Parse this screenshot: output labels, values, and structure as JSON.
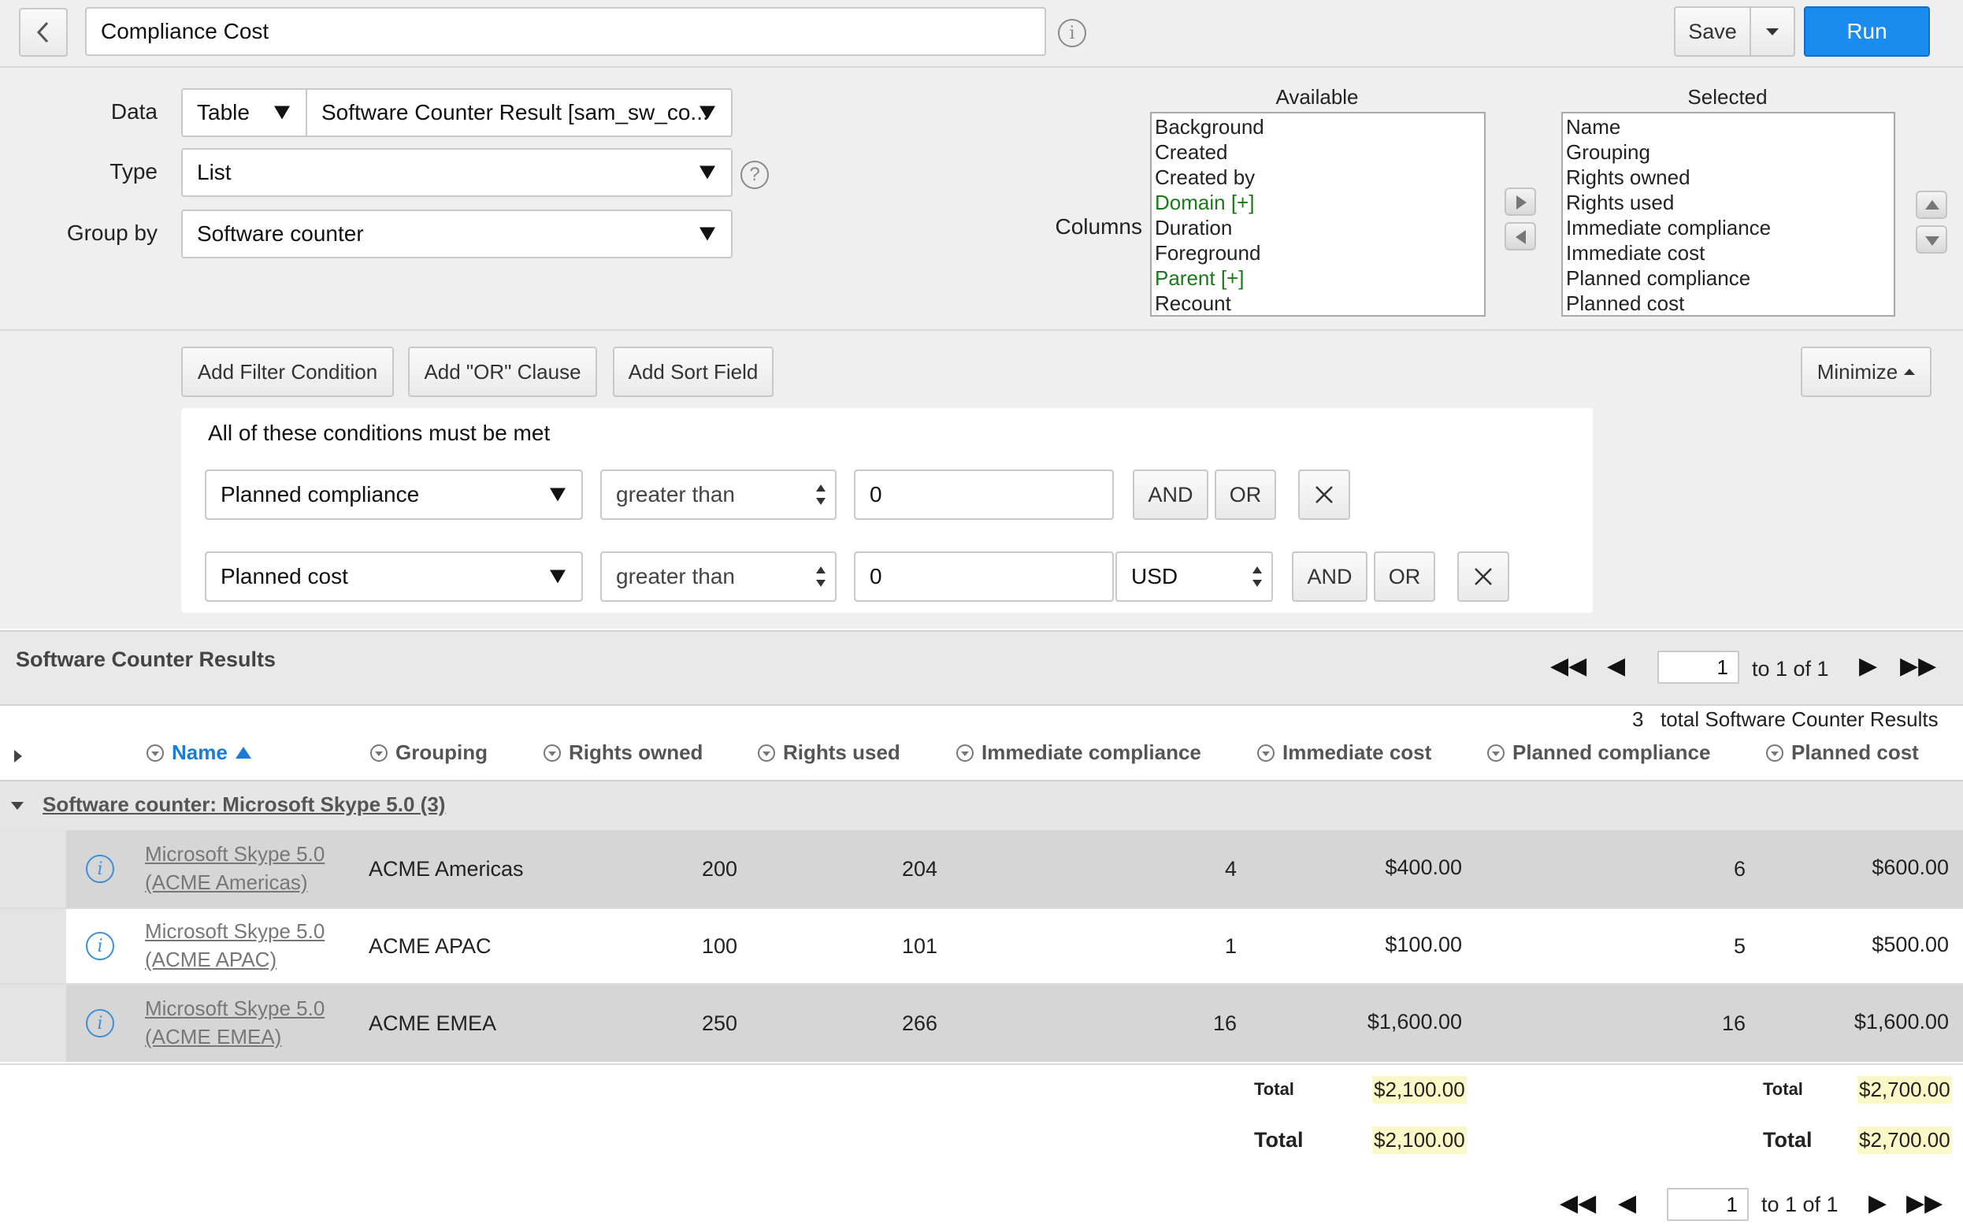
{
  "header": {
    "report_name": "Compliance Cost",
    "save_label": "Save",
    "run_label": "Run"
  },
  "form": {
    "data_label": "Data",
    "data_type_value": "Table",
    "data_table_value": "Software Counter Result [sam_sw_co...",
    "type_label": "Type",
    "type_value": "List",
    "group_by_label": "Group by",
    "group_by_value": "Software counter",
    "columns_label": "Columns",
    "available_label": "Available",
    "selected_label": "Selected",
    "available_columns": [
      {
        "label": "Background",
        "expandable": false
      },
      {
        "label": "Created",
        "expandable": false
      },
      {
        "label": "Created by",
        "expandable": false
      },
      {
        "label": "Domain [+]",
        "expandable": true
      },
      {
        "label": "Duration",
        "expandable": false
      },
      {
        "label": "Foreground",
        "expandable": false
      },
      {
        "label": "Parent [+]",
        "expandable": true
      },
      {
        "label": "Recount",
        "expandable": false
      }
    ],
    "selected_columns": [
      "Name",
      "Grouping",
      "Rights owned",
      "Rights used",
      "Immediate compliance",
      "Immediate cost",
      "Planned compliance",
      "Planned cost"
    ]
  },
  "filters": {
    "add_filter_label": "Add Filter Condition",
    "add_or_label": "Add \"OR\" Clause",
    "add_sort_label": "Add Sort Field",
    "minimize_label": "Minimize",
    "conditions_heading": "All of these conditions must be met",
    "conditions": [
      {
        "field": "Planned compliance",
        "operator": "greater than",
        "value": "0",
        "and_label": "AND",
        "or_label": "OR"
      },
      {
        "field": "Planned cost",
        "operator": "greater than",
        "value": "0",
        "currency": "USD",
        "and_label": "AND",
        "or_label": "OR"
      }
    ]
  },
  "results": {
    "title": "Software Counter Results",
    "pager": {
      "page": "1",
      "range_text": "to 1 of 1"
    },
    "total_count": "3",
    "total_text": "total Software Counter Results",
    "columns": [
      "Name",
      "Grouping",
      "Rights owned",
      "Rights used",
      "Immediate compliance",
      "Immediate cost",
      "Planned compliance",
      "Planned cost"
    ],
    "group_label": "Software counter: Microsoft Skype 5.0 (3)",
    "rows": [
      {
        "name_line1": "Microsoft Skype 5.0",
        "name_line2": "(ACME Americas)",
        "grouping": "ACME Americas",
        "rights_owned": "200",
        "rights_used": "204",
        "immediate_compliance": "4",
        "immediate_cost": "$400.00",
        "planned_compliance": "6",
        "planned_cost": "$600.00"
      },
      {
        "name_line1": "Microsoft Skype 5.0",
        "name_line2": "(ACME APAC)",
        "grouping": "ACME APAC",
        "rights_owned": "100",
        "rights_used": "101",
        "immediate_compliance": "1",
        "immediate_cost": "$100.00",
        "planned_compliance": "5",
        "planned_cost": "$500.00"
      },
      {
        "name_line1": "Microsoft Skype 5.0",
        "name_line2": "(ACME EMEA)",
        "grouping": "ACME EMEA",
        "rights_owned": "250",
        "rights_used": "266",
        "immediate_compliance": "16",
        "immediate_cost": "$1,600.00",
        "planned_compliance": "16",
        "planned_cost": "$1,600.00"
      }
    ],
    "group_total": {
      "label": "Total",
      "immediate_cost": "$2,100.00",
      "planned_cost": "$2,700.00"
    },
    "grand_total": {
      "label": "Total",
      "immediate_cost": "$2,100.00",
      "planned_cost": "$2,700.00"
    },
    "bottom_pager": {
      "page": "1",
      "range_text": "to 1 of 1"
    }
  },
  "colors": {
    "run_button": "#1a8cf0",
    "link": "#1a7ad8",
    "expandable_column": "#1a7a1a",
    "total_highlight": "#fbf8c8"
  },
  "icons": [
    "back-chevron-icon",
    "info-icon",
    "help-icon",
    "move-right-icon",
    "move-left-icon",
    "move-up-icon",
    "move-down-icon",
    "close-icon",
    "first-page-icon",
    "prev-page-icon",
    "next-page-icon",
    "last-page-icon",
    "sort-ascending-icon",
    "column-menu-icon",
    "row-info-icon"
  ]
}
